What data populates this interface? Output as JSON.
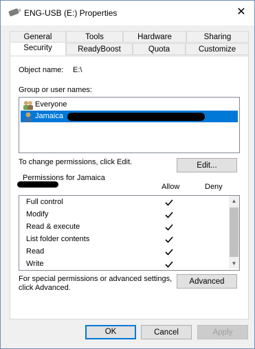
{
  "window": {
    "title": "ENG-USB (E:) Properties",
    "close_icon": "close-icon"
  },
  "tabs_row1": [
    {
      "label": "General"
    },
    {
      "label": "Tools"
    },
    {
      "label": "Hardware"
    },
    {
      "label": "Sharing"
    }
  ],
  "tabs_row2": [
    {
      "label": "Security"
    },
    {
      "label": "ReadyBoost"
    },
    {
      "label": "Quota"
    },
    {
      "label": "Customize"
    }
  ],
  "active_tab": "Security",
  "object": {
    "label": "Object name:",
    "value": "E:\\"
  },
  "groups": {
    "label": "Group or user names:",
    "items": [
      {
        "name": "Everyone",
        "icon": "users-group-icon",
        "selected": false
      },
      {
        "name": "Jamaica",
        "icon": "user-icon",
        "selected": true
      }
    ]
  },
  "change_text": "To change permissions, click Edit.",
  "edit_button": "Edit...",
  "permissions": {
    "label": "Permissions for Jamaica",
    "allow_header": "Allow",
    "deny_header": "Deny",
    "rows": [
      {
        "name": "Full control",
        "allow": true,
        "deny": false
      },
      {
        "name": "Modify",
        "allow": true,
        "deny": false
      },
      {
        "name": "Read & execute",
        "allow": true,
        "deny": false
      },
      {
        "name": "List folder contents",
        "allow": true,
        "deny": false
      },
      {
        "name": "Read",
        "allow": true,
        "deny": false
      },
      {
        "name": "Write",
        "allow": true,
        "deny": false
      }
    ]
  },
  "special_text_1": "For special permissions or advanced settings,",
  "special_text_2": "click Advanced.",
  "advanced_button": "Advanced",
  "footer": {
    "ok": "OK",
    "cancel": "Cancel",
    "apply": "Apply"
  },
  "colors": {
    "selection": "#0078d7",
    "panel": "#ffffff",
    "window": "#f0f0f0"
  }
}
